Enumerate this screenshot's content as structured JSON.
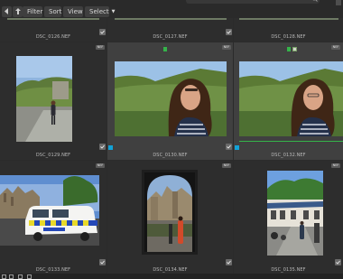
{
  "toolbar": {
    "filter_label": "Filter",
    "sort_label": "Sort",
    "view_label": "View",
    "select_label": "Select"
  },
  "colors": {
    "selection_accent": "#12a2d6",
    "flag_green": "#35b34a",
    "selected_cell_bg": "#404040"
  },
  "grid": {
    "top_row": [
      {
        "filename": "DSC_0126.NEF",
        "checked": true
      },
      {
        "filename": "DSC_0127.NEF",
        "checked": true
      },
      {
        "filename": "DSC_0128.NEF",
        "checked": false
      }
    ],
    "middle_row": [
      {
        "filename": "DSC_0129.NEF",
        "badge": "NEF",
        "checked": true
      },
      {
        "filename": "DSC_0130.NEF",
        "badge": "NEF",
        "checked": true,
        "selected": true
      },
      {
        "filename": "DSC_0132.NEF",
        "badge": "NEF",
        "checked": false,
        "selected": true
      }
    ],
    "bottom_row": [
      {
        "filename": "DSC_0133.NEF",
        "badge": "NEF",
        "checked": true
      },
      {
        "filename": "DSC_0134.NEF",
        "badge": "NEF",
        "checked": true
      },
      {
        "filename": "DSC_0135.NEF",
        "badge": "NEF",
        "checked": true
      }
    ]
  }
}
